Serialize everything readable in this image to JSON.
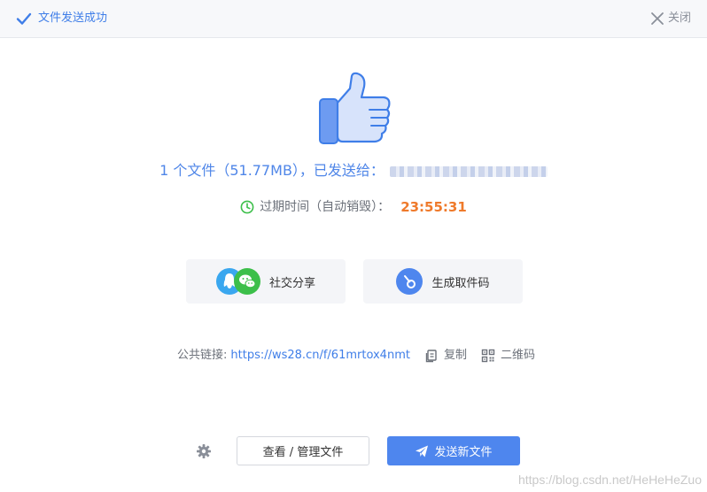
{
  "header": {
    "title": "文件发送成功",
    "close_label": "关闭"
  },
  "summary": {
    "text": "1 个文件（51.77MB），已发送给："
  },
  "expire": {
    "label": "过期时间（自动销毁）：",
    "time": "23:55:31"
  },
  "actions": {
    "social_share": "社交分享",
    "generate_code": "生成取件码"
  },
  "link": {
    "label": "公共链接:",
    "url": "https://ws28.cn/f/61mrtox4nmt",
    "copy": "复制",
    "qrcode": "二维码"
  },
  "footer": {
    "manage": "查看 / 管理文件",
    "send_new": "发送新文件"
  },
  "watermark": "https://blog.csdn.net/HeHeHeZuo",
  "colors": {
    "accent": "#4e86ee",
    "link": "#3f7ee8",
    "timer": "#ef7a2b",
    "clock_green": "#3cbf4a"
  }
}
